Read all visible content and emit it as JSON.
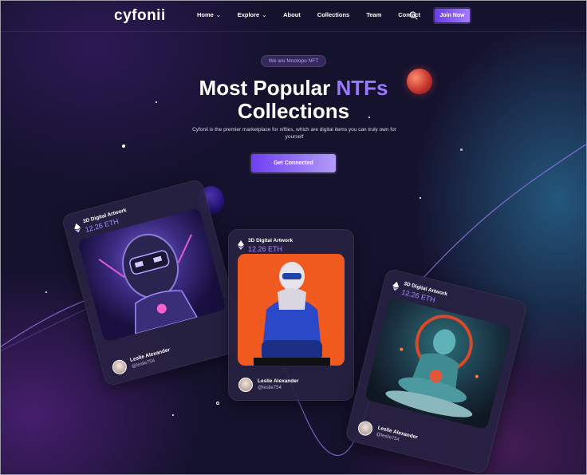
{
  "brand": {
    "logo": "cyfonii"
  },
  "nav": {
    "items": [
      {
        "label": "Home",
        "has_dropdown": true
      },
      {
        "label": "Explore",
        "has_dropdown": true
      },
      {
        "label": "About",
        "has_dropdown": false
      },
      {
        "label": "Collections",
        "has_dropdown": false
      },
      {
        "label": "Team",
        "has_dropdown": false
      },
      {
        "label": "Contact",
        "has_dropdown": false
      }
    ],
    "search_icon": "search-icon",
    "join_label": "Join Now"
  },
  "hero": {
    "badge": "We are Mootopo NFT",
    "title_line1_plain": "Most Popular ",
    "title_line1_accent": "NTFs",
    "title_line2": "Collections",
    "subtitle": "Cyfonii is the premier marketplace for nifties, which are digital items you can truly own for yourself",
    "cta_label": "Get Connected"
  },
  "cards": [
    {
      "label": "3D Digital Artwork",
      "price": "12.26 ETH",
      "owner_name": "Leslie Alexander",
      "owner_handle": "@leslie754",
      "icon": "ethereum-icon"
    },
    {
      "label": "3D Digital Artwork",
      "price": "12.26 ETH",
      "owner_name": "Leslie Alexander",
      "owner_handle": "@leslie754",
      "icon": "ethereum-icon"
    },
    {
      "label": "3D Digital Artwork",
      "price": "12.26 ETH",
      "owner_name": "Leslie Alexander",
      "owner_handle": "@leslie754",
      "icon": "ethereum-icon"
    }
  ],
  "colors": {
    "accent": "#9b79ff",
    "button_start": "#6a3cf0",
    "button_end": "#a77bff",
    "background": "#15122e"
  }
}
